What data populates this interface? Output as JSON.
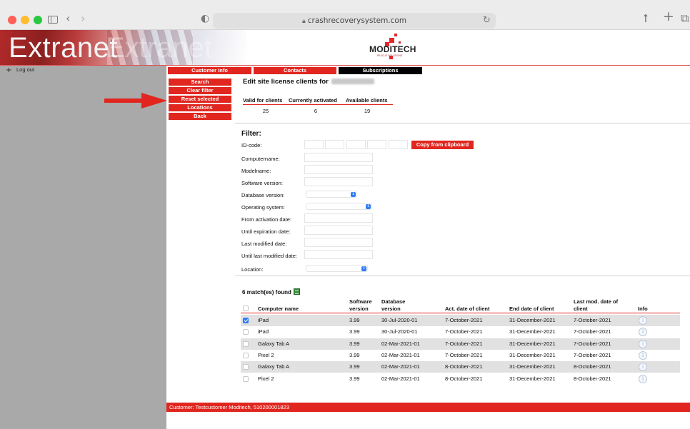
{
  "browser": {
    "url": "crashrecoverysystem.com"
  },
  "banner": {
    "title": "Extranet",
    "logo_text": "MODITECH",
    "logo_sub": "RESCUE SOLUTIONS"
  },
  "sidebar": {
    "logout_label": "Log out"
  },
  "tabs": [
    {
      "label": "Customer info",
      "active": false
    },
    {
      "label": "Contacts",
      "active": false
    },
    {
      "label": "Subscriptions",
      "active": true
    }
  ],
  "actions": [
    "Search",
    "Clear filter",
    "Reset selected",
    "Locations",
    "Back"
  ],
  "page": {
    "title": "Edit site license clients for"
  },
  "stats": {
    "headers": [
      "Valid for clients",
      "Currently activated",
      "Available clients"
    ],
    "values": [
      "25",
      "6",
      "19"
    ]
  },
  "filter": {
    "heading": "Filter:",
    "id_label": "ID-code:",
    "copy_button": "Copy from clipboard",
    "fields": [
      "Computername:",
      "Modelname:",
      "Software version:",
      "Database version:",
      "Operating system:",
      "From activation date:",
      "Until expiration date:",
      "Last modified date:",
      "Until last modified date:",
      "Location:"
    ]
  },
  "results": {
    "summary": "6 match(es) found",
    "headers": {
      "computer": "Computer name",
      "software": [
        "Software",
        "version"
      ],
      "database": [
        "Database",
        "version"
      ],
      "act": "Act. date of client",
      "end": "End date of client",
      "lastmod": [
        "Last mod. date of",
        "client"
      ],
      "info": "Info"
    },
    "rows": [
      {
        "checked": true,
        "name": "iPad",
        "sw": "3.99",
        "db": "30-Jul-2020-01",
        "act": "7-October-2021",
        "end": "31-December-2021",
        "mod": "7-October-2021"
      },
      {
        "checked": false,
        "name": "iPad",
        "sw": "3.99",
        "db": "30-Jul-2020-01",
        "act": "7-October-2021",
        "end": "31-December-2021",
        "mod": "7-October-2021"
      },
      {
        "checked": false,
        "name": "Galaxy Tab A",
        "sw": "3.99",
        "db": "02-Mar-2021-01",
        "act": "7-October-2021",
        "end": "31-December-2021",
        "mod": "7-October-2021"
      },
      {
        "checked": false,
        "name": "Pixel 2",
        "sw": "3.99",
        "db": "02-Mar-2021-01",
        "act": "7-October-2021",
        "end": "31-December-2021",
        "mod": "7-October-2021"
      },
      {
        "checked": false,
        "name": "Galaxy Tab A",
        "sw": "3.99",
        "db": "02-Mar-2021-01",
        "act": "8-October-2021",
        "end": "31-December-2021",
        "mod": "8-October-2021"
      },
      {
        "checked": false,
        "name": "Pixel 2",
        "sw": "3.99",
        "db": "02-Mar-2021-01",
        "act": "8-October-2021",
        "end": "31-December-2021",
        "mod": "8-October-2021"
      }
    ]
  },
  "footer": {
    "text": "Customer: Testcustomer Moditech, 510200001823"
  },
  "colors": {
    "accent": "#e0261f",
    "sidebar": "#a9a9a9",
    "row_alt": "#e1e1e1",
    "checkbox": "#2f7cf6"
  }
}
